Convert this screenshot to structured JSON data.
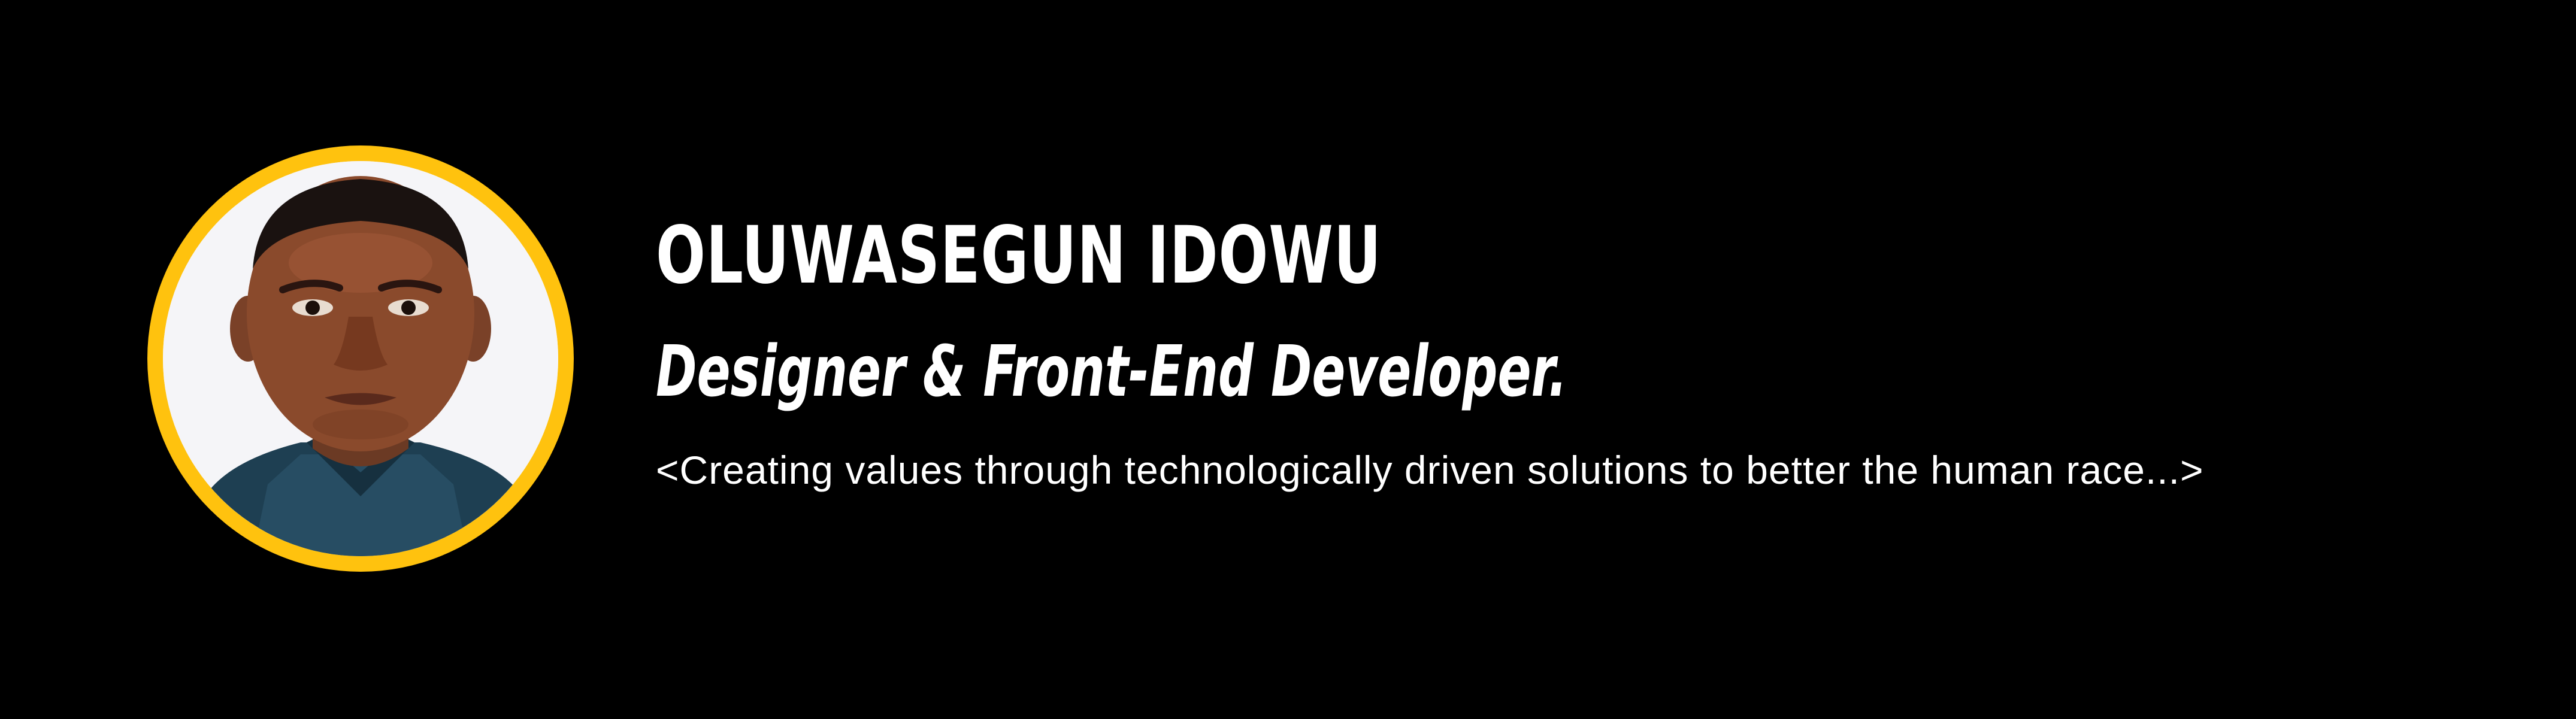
{
  "profile": {
    "name": "OLUWASEGUN IDOWU",
    "role": "Designer & Front-End Developer.",
    "tagline": "<Creating values through technologically driven solutions to better the human race...>",
    "avatar_icon": "profile-photo"
  },
  "colors": {
    "background": "#000000",
    "accent": "#FFC20E",
    "text": "#FFFFFF"
  }
}
